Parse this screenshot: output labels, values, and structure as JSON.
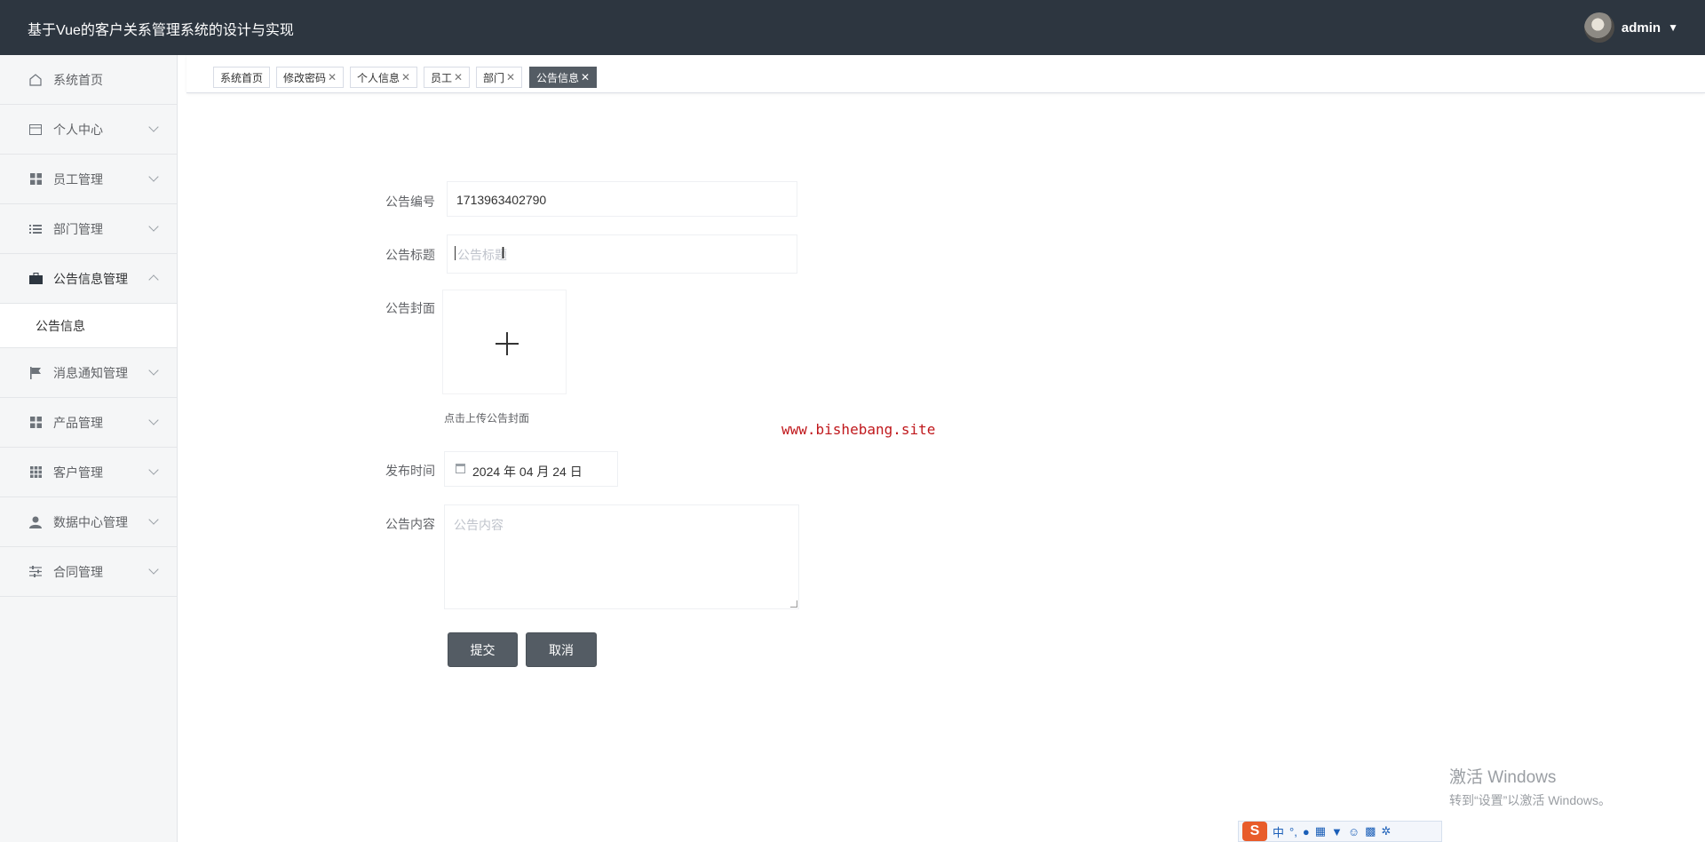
{
  "header": {
    "title": "基于Vue的客户关系管理系统的设计与实现",
    "username": "admin"
  },
  "sidebar": {
    "items": [
      {
        "label": "系统首页",
        "icon": "home-icon"
      },
      {
        "label": "个人中心",
        "icon": "card-icon"
      },
      {
        "label": "员工管理",
        "icon": "grid-icon"
      },
      {
        "label": "部门管理",
        "icon": "list-icon"
      },
      {
        "label": "公告信息管理",
        "icon": "briefcase-icon"
      },
      {
        "label": "消息通知管理",
        "icon": "flag-icon"
      },
      {
        "label": "产品管理",
        "icon": "grid-icon"
      },
      {
        "label": "客户管理",
        "icon": "apps-icon"
      },
      {
        "label": "数据中心管理",
        "icon": "user-icon"
      },
      {
        "label": "合同管理",
        "icon": "sliders-icon"
      }
    ],
    "sub_item": "公告信息"
  },
  "tabs": [
    {
      "label": "系统首页",
      "closable": false
    },
    {
      "label": "修改密码",
      "closable": true
    },
    {
      "label": "个人信息",
      "closable": true
    },
    {
      "label": "员工",
      "closable": true
    },
    {
      "label": "部门",
      "closable": true
    },
    {
      "label": "公告信息",
      "closable": true,
      "active": true
    }
  ],
  "form": {
    "number_label": "公告编号",
    "number_value": "1713963402790",
    "title_label": "公告标题",
    "title_placeholder": "公告标题",
    "cover_label": "公告封面",
    "cover_hint": "点击上传公告封面",
    "date_label": "发布时间",
    "date_value": "2024 年 04 月 24 日",
    "content_label": "公告内容",
    "content_placeholder": "公告内容",
    "submit": "提交",
    "cancel": "取消"
  },
  "watermark": "www.bishebang.site",
  "windows": {
    "line1": "激活 Windows",
    "line2": "转到“设置”以激活 Windows。"
  },
  "tray": {
    "ime": "中"
  },
  "colors": {
    "header_bg": "#2d3640",
    "button_bg": "#545c64",
    "watermark": "#c0181c"
  }
}
